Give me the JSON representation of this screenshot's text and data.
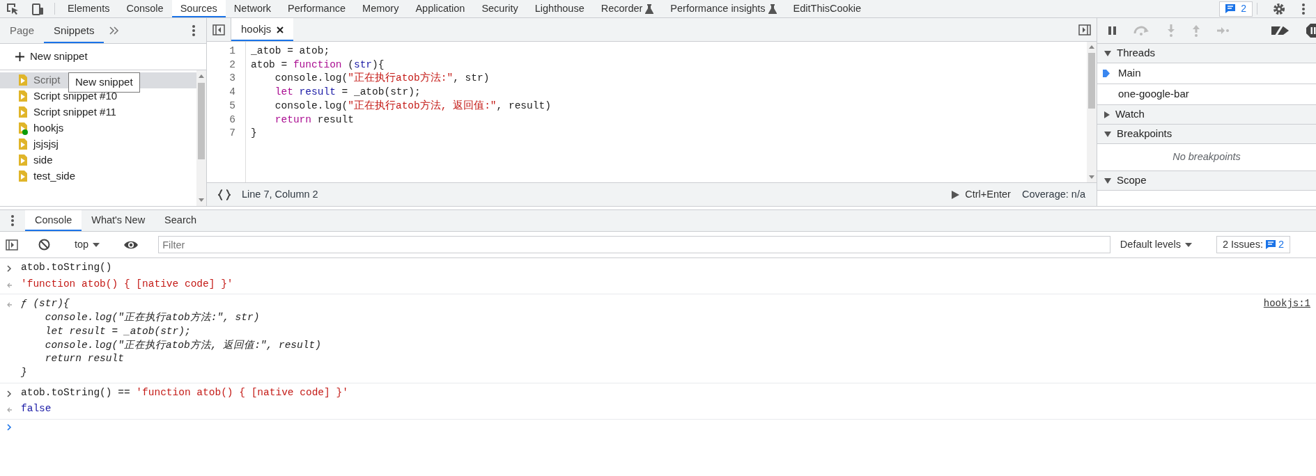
{
  "devtools_tabs": [
    {
      "label": "Elements",
      "selected": false,
      "experimental": false
    },
    {
      "label": "Console",
      "selected": false,
      "experimental": false
    },
    {
      "label": "Sources",
      "selected": true,
      "experimental": false
    },
    {
      "label": "Network",
      "selected": false,
      "experimental": false
    },
    {
      "label": "Performance",
      "selected": false,
      "experimental": false
    },
    {
      "label": "Memory",
      "selected": false,
      "experimental": false
    },
    {
      "label": "Application",
      "selected": false,
      "experimental": false
    },
    {
      "label": "Security",
      "selected": false,
      "experimental": false
    },
    {
      "label": "Lighthouse",
      "selected": false,
      "experimental": false
    },
    {
      "label": "Recorder",
      "selected": false,
      "experimental": true
    },
    {
      "label": "Performance insights",
      "selected": false,
      "experimental": true
    },
    {
      "label": "EditThisCookie",
      "selected": false,
      "experimental": false
    }
  ],
  "issues_badge": "2",
  "navigator": {
    "tabs": [
      {
        "label": "Page",
        "selected": false
      },
      {
        "label": "Snippets",
        "selected": true
      }
    ],
    "new_snippet": "New snippet",
    "items": [
      {
        "label": "Script",
        "selected": true,
        "dot": false
      },
      {
        "label": "Script snippet #10",
        "selected": false,
        "dot": false
      },
      {
        "label": "Script snippet #11",
        "selected": false,
        "dot": false
      },
      {
        "label": "hookjs",
        "selected": false,
        "dot": true
      },
      {
        "label": "jsjsjsj",
        "selected": false,
        "dot": false
      },
      {
        "label": "side",
        "selected": false,
        "dot": false
      },
      {
        "label": "test_side",
        "selected": false,
        "dot": false
      }
    ],
    "tooltip": "New snippet"
  },
  "editor": {
    "tabs": [
      {
        "label": "hookjs",
        "selected": true
      }
    ],
    "lines": [
      {
        "number": "1",
        "tokens": [
          {
            "kind": "plain",
            "text": "_atob = atob;"
          }
        ]
      },
      {
        "number": "2",
        "tokens": [
          {
            "kind": "plain",
            "text": "atob = "
          },
          {
            "kind": "keyword",
            "text": "function"
          },
          {
            "kind": "plain",
            "text": " ("
          },
          {
            "kind": "variable",
            "text": "str"
          },
          {
            "kind": "plain",
            "text": "){"
          }
        ]
      },
      {
        "number": "3",
        "tokens": [
          {
            "kind": "plain",
            "text": "    console.log("
          },
          {
            "kind": "string",
            "text": "\"正在执行atob方法:\""
          },
          {
            "kind": "plain",
            "text": ", str)"
          }
        ]
      },
      {
        "number": "4",
        "tokens": [
          {
            "kind": "keyword",
            "text": "    let"
          },
          {
            "kind": "variable",
            "text": " result"
          },
          {
            "kind": "plain",
            "text": " = _atob(str);"
          }
        ]
      },
      {
        "number": "5",
        "tokens": [
          {
            "kind": "plain",
            "text": "    console.log("
          },
          {
            "kind": "string",
            "text": "\"正在执行atob方法, 返回值:\""
          },
          {
            "kind": "plain",
            "text": ", result)"
          }
        ]
      },
      {
        "number": "6",
        "tokens": [
          {
            "kind": "keyword",
            "text": "    return"
          },
          {
            "kind": "plain",
            "text": " result"
          }
        ]
      },
      {
        "number": "7",
        "tokens": [
          {
            "kind": "plain",
            "text": "}"
          }
        ]
      }
    ],
    "position": "Line 7, Column 2",
    "run_shortcut": "Ctrl+Enter",
    "coverage": "Coverage: n/a"
  },
  "debugger": {
    "sections": [
      {
        "title": "Threads",
        "expanded": true,
        "threads": [
          {
            "label": "Main",
            "selected": true
          },
          {
            "label": "one-google-bar",
            "selected": false
          }
        ]
      },
      {
        "title": "Watch",
        "expanded": false
      },
      {
        "title": "Breakpoints",
        "expanded": true,
        "empty_text": "No breakpoints"
      },
      {
        "title": "Scope",
        "expanded": true
      }
    ]
  },
  "drawer": {
    "tabs": [
      {
        "label": "Console",
        "selected": true
      },
      {
        "label": "What's New",
        "selected": false
      },
      {
        "label": "Search",
        "selected": false
      }
    ],
    "context": "top",
    "filter": {
      "placeholder": "Filter"
    },
    "levels": "Default levels",
    "issues_label": "2 Issues:",
    "issues_count": "2",
    "groups": [
      {
        "messages": [
          {
            "kind": "input",
            "lines": [
              [
                {
                  "kind": "plain",
                  "text": "atob.toString()"
                }
              ]
            ]
          },
          {
            "kind": "result",
            "lines": [
              [
                {
                  "kind": "string",
                  "text": "'function atob() { [native code] }'"
                }
              ]
            ]
          }
        ]
      },
      {
        "messages": [
          {
            "kind": "function",
            "source": "hookjs:1",
            "lines": [
              [
                {
                  "kind": "plain",
                  "text": "ƒ (str){"
                }
              ],
              [
                {
                  "kind": "plain",
                  "text": "    console.log(\"正在执行atob方法:\", str)"
                }
              ],
              [
                {
                  "kind": "plain",
                  "text": "    let result = _atob(str);"
                }
              ],
              [
                {
                  "kind": "plain",
                  "text": "    console.log(\"正在执行atob方法, 返回值:\", result)"
                }
              ],
              [
                {
                  "kind": "plain",
                  "text": "    return result"
                }
              ],
              [
                {
                  "kind": "plain",
                  "text": "}"
                }
              ]
            ]
          }
        ]
      },
      {
        "messages": [
          {
            "kind": "input",
            "lines": [
              [
                {
                  "kind": "plain",
                  "text": "atob.toString() == "
                },
                {
                  "kind": "string",
                  "text": "'function atob() { [native code] }'"
                }
              ]
            ]
          },
          {
            "kind": "result",
            "lines": [
              [
                {
                  "kind": "literal",
                  "text": "false"
                }
              ]
            ]
          }
        ]
      }
    ]
  }
}
